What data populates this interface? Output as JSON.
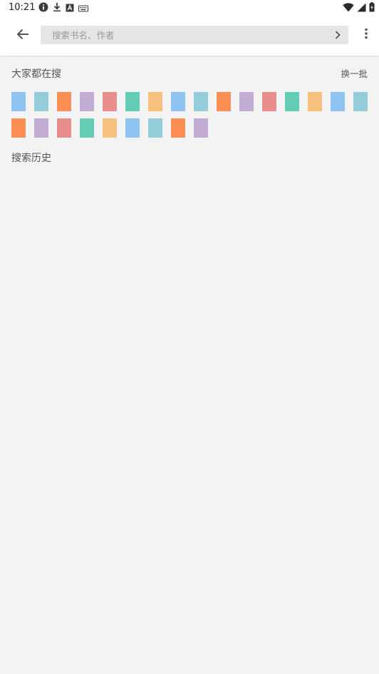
{
  "status_bar": {
    "time": "10:21",
    "left_icons": [
      "info-icon",
      "download-icon",
      "text-a-icon",
      "keyboard-icon"
    ],
    "right_icons": [
      "wifi-icon",
      "signal-icon",
      "battery-icon"
    ]
  },
  "app_bar": {
    "search_placeholder": "搜索书名、作者",
    "search_value": ""
  },
  "hot_search": {
    "title": "大家都在搜",
    "refresh_label": "换一批",
    "items": [
      {
        "color": "#90c4f0"
      },
      {
        "color": "#94ccd8"
      },
      {
        "color": "#f98f55"
      },
      {
        "color": "#c1add4"
      },
      {
        "color": "#e88e8f"
      },
      {
        "color": "#65ccb5"
      },
      {
        "color": "#f7c07f"
      },
      {
        "color": "#90c4f0"
      },
      {
        "color": "#94ccd8"
      },
      {
        "color": "#f98f55"
      },
      {
        "color": "#c1add4"
      },
      {
        "color": "#e88e8f"
      },
      {
        "color": "#65ccb5"
      },
      {
        "color": "#f7c07f"
      },
      {
        "color": "#90c4f0"
      },
      {
        "color": "#94ccd8"
      },
      {
        "color": "#f98f55"
      },
      {
        "color": "#c1add4"
      },
      {
        "color": "#e88e8f"
      },
      {
        "color": "#65ccb5"
      },
      {
        "color": "#f7c07f"
      },
      {
        "color": "#90c4f0"
      },
      {
        "color": "#94ccd8"
      },
      {
        "color": "#f98f55"
      },
      {
        "color": "#c1add4"
      }
    ]
  },
  "history": {
    "title": "搜索历史"
  },
  "colors": {
    "page_background": "#f3f3f3",
    "bar_background": "#ffffff",
    "search_field": "#e5e5e5"
  }
}
